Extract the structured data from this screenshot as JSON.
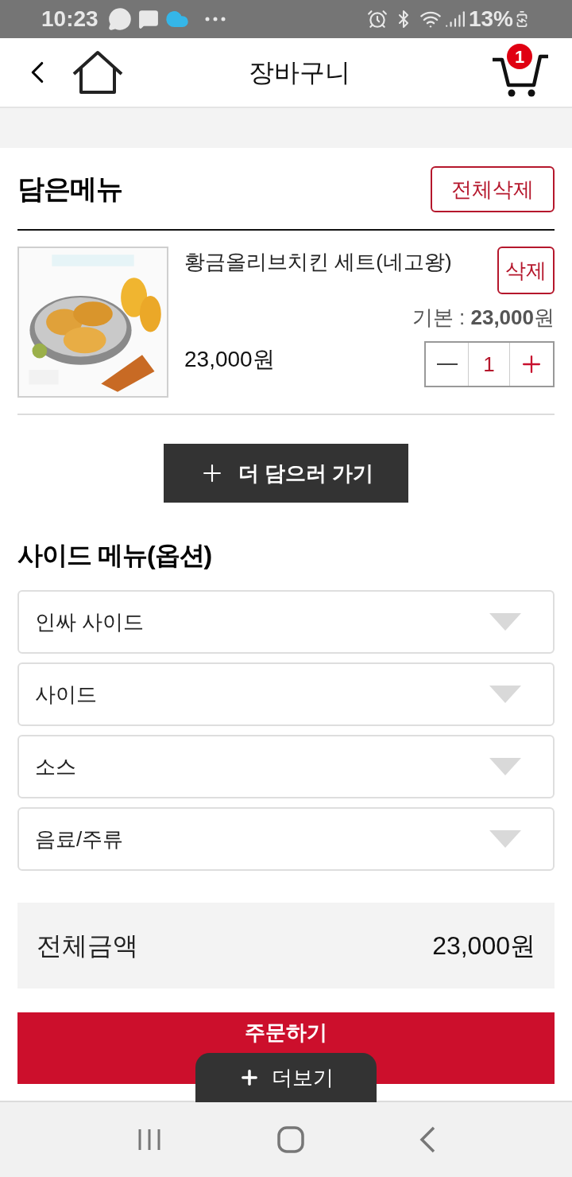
{
  "status_bar": {
    "time": "10:23",
    "battery": "13%"
  },
  "header": {
    "title": "장바구니",
    "cart_count": "1"
  },
  "cart": {
    "title": "담은메뉴",
    "delete_all": "전체삭제",
    "items": [
      {
        "kind": "picture",
        "name": "황금올리브치킨 세트(네고왕)",
        "delete": "삭제",
        "base_price": "기본 : **23,000**원",
        "price": "23,000원",
        "quantity": "1"
      }
    ]
  },
  "add_more_button": "더 담으러 가기",
  "side_menu": {
    "title": "사이드 메뉴(옵션)",
    "options": [
      {
        "label": "인싸 사이드"
      },
      {
        "label": "사이드"
      },
      {
        "label": "소스"
      },
      {
        "label": "음료/주류"
      }
    ]
  },
  "total": {
    "label": "전체금액",
    "value": "23,000원"
  },
  "order_button": "주문하기",
  "more_tab": "더보기"
}
